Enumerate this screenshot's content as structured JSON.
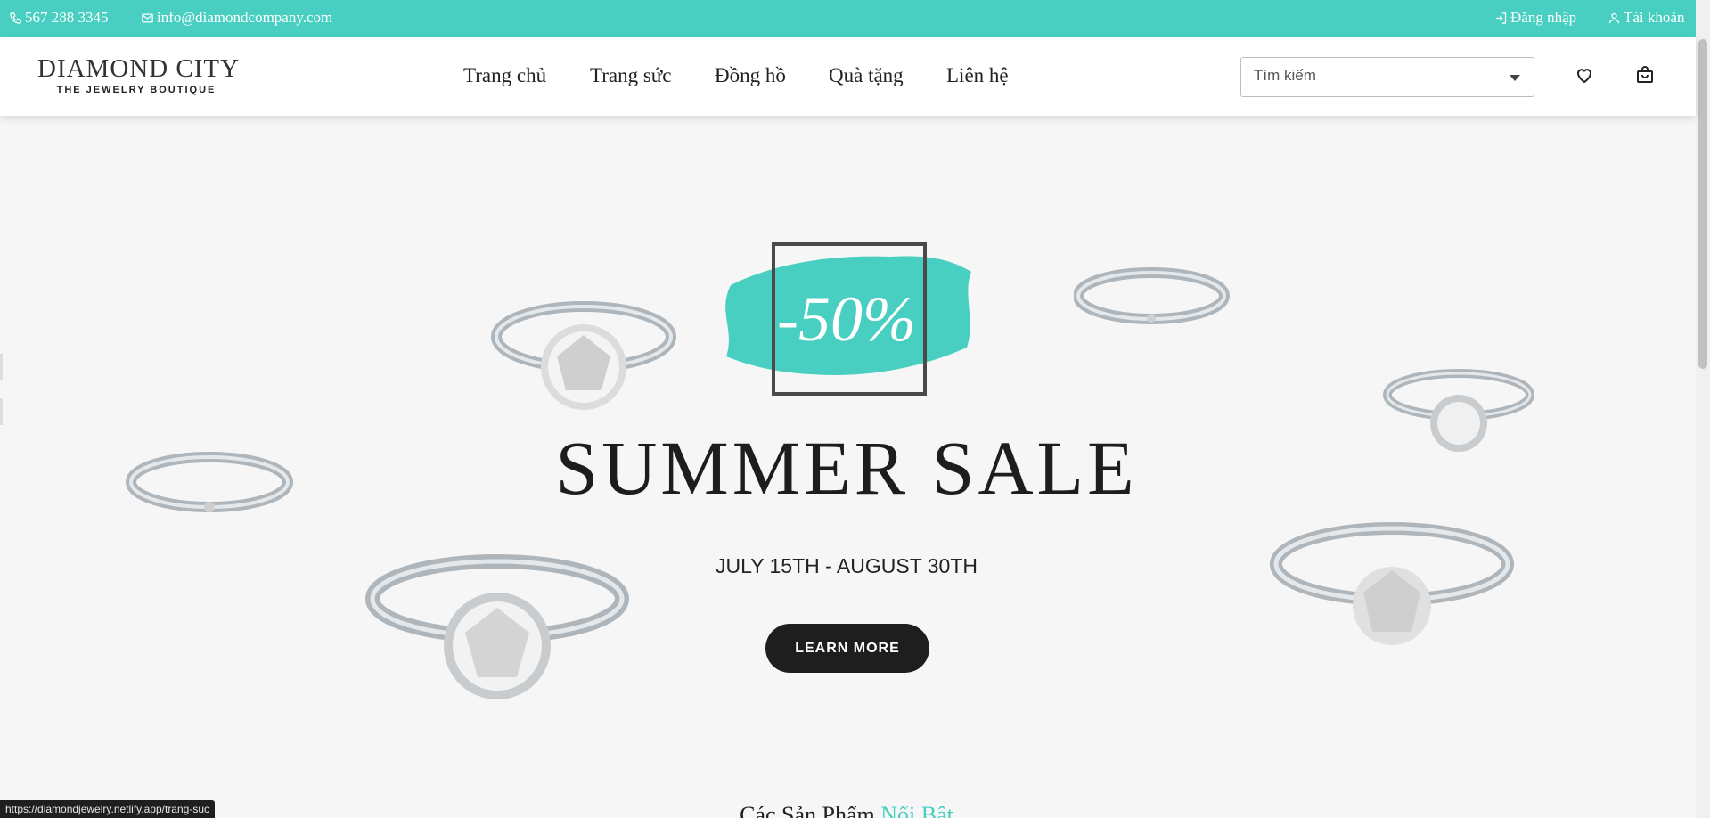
{
  "topbar": {
    "phone": "567 288 3345",
    "email": "info@diamondcompany.com",
    "login": "Đăng nhập",
    "account": "Tài khoản",
    "icons": [
      "phone-icon",
      "mail-icon",
      "login-icon",
      "user-icon"
    ],
    "bg_color": "#48cfc1"
  },
  "logo": {
    "line1": "DIAMOND CITY",
    "line2": "THE JEWELRY BOUTIQUE"
  },
  "nav": {
    "items": [
      "Trang chủ",
      "Trang sức",
      "Đồng hồ",
      "Quà tặng",
      "Liên hệ"
    ]
  },
  "search": {
    "placeholder": "Tìm kiếm"
  },
  "header_icons": [
    "heart-icon",
    "shopping-bag-icon"
  ],
  "hero": {
    "discount": "-50%",
    "headline": "SUMMER SALE",
    "dates": "JULY 15TH - AUGUST 30TH",
    "cta_label": "LEARN MORE",
    "accent_color": "#48cfc1"
  },
  "section": {
    "title_prefix": "Các Sản Phẩm ",
    "title_accent": "Nổi Bật"
  },
  "status_url": "https://diamondjewelry.netlify.app/trang-suc"
}
